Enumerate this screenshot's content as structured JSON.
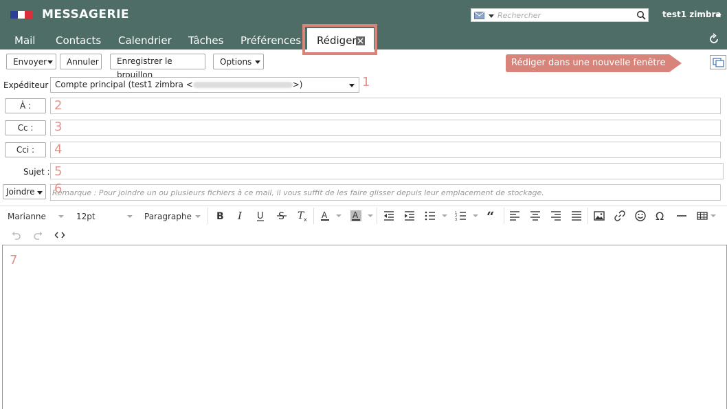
{
  "header": {
    "app_title": "MESSAGERIE",
    "search_placeholder": "Rechercher",
    "user_name": "test1 zimbra",
    "tabs": [
      {
        "label": "Mail"
      },
      {
        "label": "Contacts"
      },
      {
        "label": "Calendrier"
      },
      {
        "label": "Tâches"
      },
      {
        "label": "Préférences"
      }
    ],
    "active_tab": "Rédiger"
  },
  "toolbar": {
    "send": "Envoyer",
    "cancel": "Annuler",
    "save_draft": "Enregistrer le brouillon",
    "options": "Options"
  },
  "tooltip": "Rédiger dans une nouvelle fenêtre",
  "form": {
    "from_label": "Expéditeur :",
    "from_value_prefix": "Compte principal (test1 zimbra <",
    "from_value_suffix": ">)",
    "to_label": "À :",
    "cc_label": "Cc :",
    "bcc_label": "Cci :",
    "subject_label": "Sujet :",
    "attach_label": "Joindre",
    "attach_hint": "Remarque : Pour joindre un ou plusieurs fichiers à ce mail, il vous suffit de les faire glisser depuis leur emplacement de stockage."
  },
  "annotations": [
    "1",
    "2",
    "3",
    "4",
    "5",
    "6",
    "7"
  ],
  "editor": {
    "font": "Marianne",
    "size": "12pt",
    "block": "Paragraphe"
  },
  "colors": {
    "header_bg": "#4d6d66",
    "highlight": "#d9847b",
    "annotation": "#e4918a"
  }
}
